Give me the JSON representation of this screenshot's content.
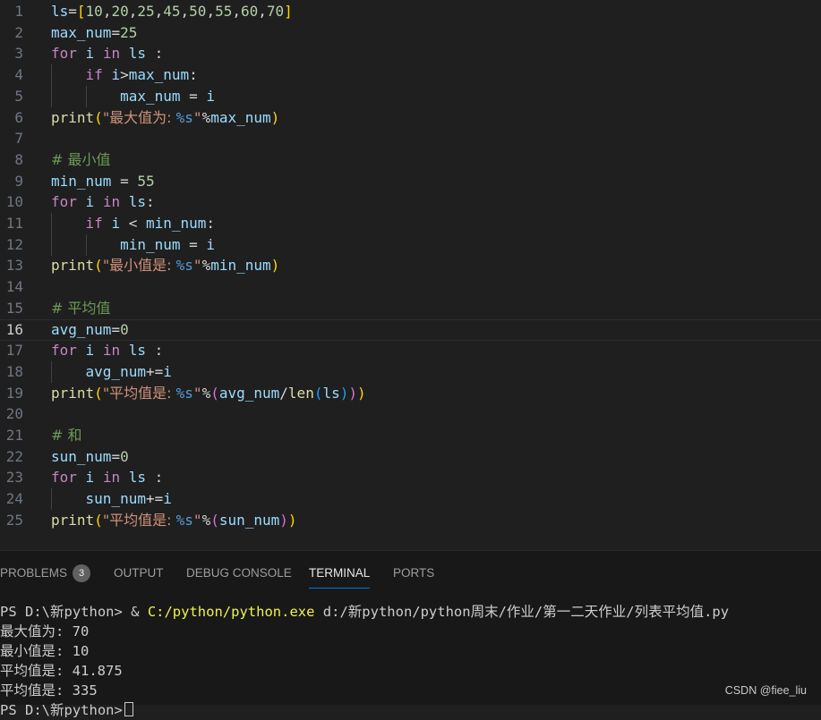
{
  "editor": {
    "lines": [
      {
        "n": "1",
        "tokens": [
          [
            "ls",
            "var"
          ],
          [
            "=",
            "op"
          ],
          [
            "[",
            "b1"
          ],
          [
            "10",
            "num"
          ],
          [
            ",",
            "op"
          ],
          [
            "20",
            "num"
          ],
          [
            ",",
            "op"
          ],
          [
            "25",
            "num"
          ],
          [
            ",",
            "op"
          ],
          [
            "45",
            "num"
          ],
          [
            ",",
            "op"
          ],
          [
            "50",
            "num"
          ],
          [
            ",",
            "op"
          ],
          [
            "55",
            "num"
          ],
          [
            ",",
            "op"
          ],
          [
            "60",
            "num"
          ],
          [
            ",",
            "op"
          ],
          [
            "70",
            "num"
          ],
          [
            "]",
            "b1"
          ]
        ]
      },
      {
        "n": "2",
        "tokens": [
          [
            "max_num",
            "var"
          ],
          [
            "=",
            "op"
          ],
          [
            "25",
            "num"
          ]
        ]
      },
      {
        "n": "3",
        "tokens": [
          [
            "for",
            "kw"
          ],
          [
            " ",
            "op"
          ],
          [
            "i",
            "var"
          ],
          [
            " ",
            "op"
          ],
          [
            "in",
            "kw"
          ],
          [
            " ",
            "op"
          ],
          [
            "ls",
            "var"
          ],
          [
            " :",
            "op"
          ]
        ]
      },
      {
        "n": "4",
        "indent": 1,
        "tokens": [
          [
            "    ",
            "op"
          ],
          [
            "if",
            "kw"
          ],
          [
            " ",
            "op"
          ],
          [
            "i",
            "var"
          ],
          [
            ">",
            "op"
          ],
          [
            "max_num",
            "var"
          ],
          [
            ":",
            "op"
          ]
        ]
      },
      {
        "n": "5",
        "indent": 2,
        "tokens": [
          [
            "        ",
            "op"
          ],
          [
            "max_num",
            "var"
          ],
          [
            " = ",
            "op"
          ],
          [
            "i",
            "var"
          ]
        ]
      },
      {
        "n": "6",
        "tokens": [
          [
            "print",
            "fn"
          ],
          [
            "(",
            "b1"
          ],
          [
            "\"最大值为: ",
            "str"
          ],
          [
            "%s",
            "fmt"
          ],
          [
            "\"",
            "str"
          ],
          [
            "%",
            "op"
          ],
          [
            "max_num",
            "var"
          ],
          [
            ")",
            "b1"
          ]
        ]
      },
      {
        "n": "7",
        "tokens": []
      },
      {
        "n": "8",
        "tokens": [
          [
            "# 最小值",
            "cm"
          ]
        ]
      },
      {
        "n": "9",
        "tokens": [
          [
            "min_num",
            "var"
          ],
          [
            " = ",
            "op"
          ],
          [
            "55",
            "num"
          ]
        ]
      },
      {
        "n": "10",
        "tokens": [
          [
            "for",
            "kw"
          ],
          [
            " ",
            "op"
          ],
          [
            "i",
            "var"
          ],
          [
            " ",
            "op"
          ],
          [
            "in",
            "kw"
          ],
          [
            " ",
            "op"
          ],
          [
            "ls",
            "var"
          ],
          [
            ":",
            "op"
          ]
        ]
      },
      {
        "n": "11",
        "indent": 1,
        "tokens": [
          [
            "    ",
            "op"
          ],
          [
            "if",
            "kw"
          ],
          [
            " ",
            "op"
          ],
          [
            "i",
            "var"
          ],
          [
            " < ",
            "op"
          ],
          [
            "min_num",
            "var"
          ],
          [
            ":",
            "op"
          ]
        ]
      },
      {
        "n": "12",
        "indent": 2,
        "tokens": [
          [
            "        ",
            "op"
          ],
          [
            "min_num",
            "var"
          ],
          [
            " = ",
            "op"
          ],
          [
            "i",
            "var"
          ]
        ]
      },
      {
        "n": "13",
        "tokens": [
          [
            "print",
            "fn"
          ],
          [
            "(",
            "b1"
          ],
          [
            "\"最小值是: ",
            "str"
          ],
          [
            "%s",
            "fmt"
          ],
          [
            "\"",
            "str"
          ],
          [
            "%",
            "op"
          ],
          [
            "min_num",
            "var"
          ],
          [
            ")",
            "b1"
          ]
        ]
      },
      {
        "n": "14",
        "tokens": []
      },
      {
        "n": "15",
        "tokens": [
          [
            "# 平均值",
            "cm"
          ]
        ]
      },
      {
        "n": "16",
        "current": true,
        "tokens": [
          [
            "avg_num",
            "var"
          ],
          [
            "=",
            "op"
          ],
          [
            "0",
            "num"
          ]
        ]
      },
      {
        "n": "17",
        "tokens": [
          [
            "for",
            "kw"
          ],
          [
            " ",
            "op"
          ],
          [
            "i",
            "var"
          ],
          [
            " ",
            "op"
          ],
          [
            "in",
            "kw"
          ],
          [
            " ",
            "op"
          ],
          [
            "ls",
            "var"
          ],
          [
            " :",
            "op"
          ]
        ]
      },
      {
        "n": "18",
        "indent": 1,
        "tokens": [
          [
            "    ",
            "op"
          ],
          [
            "avg_num",
            "var"
          ],
          [
            "+=",
            "op"
          ],
          [
            "i",
            "var"
          ]
        ]
      },
      {
        "n": "19",
        "tokens": [
          [
            "print",
            "fn"
          ],
          [
            "(",
            "b1"
          ],
          [
            "\"平均值是: ",
            "str"
          ],
          [
            "%s",
            "fmt"
          ],
          [
            "\"",
            "str"
          ],
          [
            "%",
            "op"
          ],
          [
            "(",
            "b2"
          ],
          [
            "avg_num",
            "var"
          ],
          [
            "/",
            "op"
          ],
          [
            "len",
            "fn"
          ],
          [
            "(",
            "b3"
          ],
          [
            "ls",
            "var"
          ],
          [
            ")",
            "b3"
          ],
          [
            ")",
            "b2"
          ],
          [
            ")",
            "b1"
          ]
        ]
      },
      {
        "n": "20",
        "tokens": []
      },
      {
        "n": "21",
        "tokens": [
          [
            "# 和",
            "cm"
          ]
        ]
      },
      {
        "n": "22",
        "tokens": [
          [
            "sun_num",
            "var"
          ],
          [
            "=",
            "op"
          ],
          [
            "0",
            "num"
          ]
        ]
      },
      {
        "n": "23",
        "tokens": [
          [
            "for",
            "kw"
          ],
          [
            " ",
            "op"
          ],
          [
            "i",
            "var"
          ],
          [
            " ",
            "op"
          ],
          [
            "in",
            "kw"
          ],
          [
            " ",
            "op"
          ],
          [
            "ls",
            "var"
          ],
          [
            " :",
            "op"
          ]
        ]
      },
      {
        "n": "24",
        "indent": 1,
        "tokens": [
          [
            "    ",
            "op"
          ],
          [
            "sun_num",
            "var"
          ],
          [
            "+=",
            "op"
          ],
          [
            "i",
            "var"
          ]
        ]
      },
      {
        "n": "25",
        "tokens": [
          [
            "print",
            "fn"
          ],
          [
            "(",
            "b1"
          ],
          [
            "\"平均值是: ",
            "str"
          ],
          [
            "%s",
            "fmt"
          ],
          [
            "\"",
            "str"
          ],
          [
            "%",
            "op"
          ],
          [
            "(",
            "b2"
          ],
          [
            "sun_num",
            "var"
          ],
          [
            ")",
            "b2"
          ],
          [
            ")",
            "b1"
          ]
        ]
      }
    ]
  },
  "panel": {
    "tabs": [
      {
        "label": "PROBLEMS",
        "badge": "3",
        "active": false
      },
      {
        "label": "OUTPUT",
        "active": false
      },
      {
        "label": "DEBUG CONSOLE",
        "active": false
      },
      {
        "label": "TERMINAL",
        "active": true
      },
      {
        "label": "PORTS",
        "active": false
      }
    ],
    "terminal": {
      "prompt": "PS D:\\新python> & ",
      "exe": "C:/python/python.exe",
      "script_arg": " d:/新python/python周末/作业/第一二天作业/列表平均值.py",
      "output": [
        "最大值为: 70",
        "最小值是: 10",
        "平均值是: 41.875",
        "平均值是: 335"
      ],
      "next_prompt": "PS D:\\新python>"
    }
  },
  "watermark": "CSDN @fiee_liu"
}
